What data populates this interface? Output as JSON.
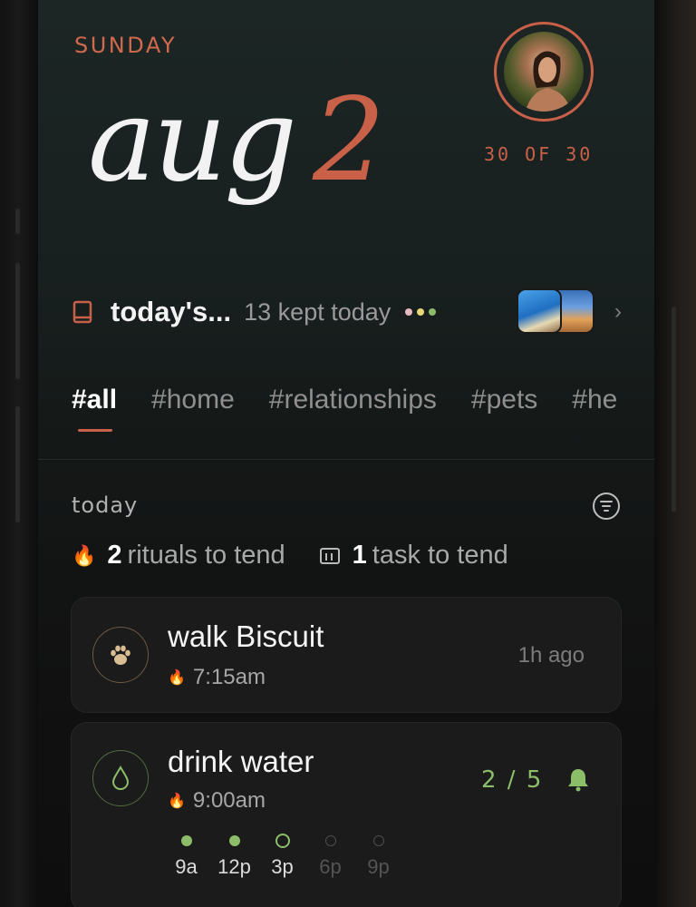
{
  "header": {
    "weekday": "SUNDAY",
    "month": "aug",
    "day": "2",
    "streak": "30 OF 30"
  },
  "kept": {
    "title": "today's...",
    "count_text": "13 kept today",
    "dot_colors": [
      "#e8b9c0",
      "#e7d77a",
      "#8cbd68"
    ]
  },
  "tabs": [
    {
      "label": "#all",
      "active": true
    },
    {
      "label": "#home",
      "active": false
    },
    {
      "label": "#relationships",
      "active": false
    },
    {
      "label": "#pets",
      "active": false
    },
    {
      "label": "#he",
      "active": false
    }
  ],
  "today": {
    "section_label": "today",
    "rituals_count": "2",
    "rituals_label": "rituals to tend",
    "tasks_count": "1",
    "tasks_label": "task to tend"
  },
  "cards": [
    {
      "title": "walk Biscuit",
      "time": "7:15am",
      "status": "1h ago",
      "icon": "paw-icon",
      "accent": "#d9bd93"
    },
    {
      "title": "drink water",
      "time": "9:00am",
      "progress_text": "2 / 5",
      "progress": {
        "done": 2,
        "total": 5
      },
      "icon": "water-drop-icon",
      "accent": "#8cbd68",
      "slots": [
        {
          "label": "9a",
          "state": "done"
        },
        {
          "label": "12p",
          "state": "done"
        },
        {
          "label": "3p",
          "state": "current"
        },
        {
          "label": "6p",
          "state": "future"
        },
        {
          "label": "9p",
          "state": "future"
        }
      ]
    }
  ],
  "colors": {
    "accent": "#c96048",
    "success": "#8cbd68"
  }
}
